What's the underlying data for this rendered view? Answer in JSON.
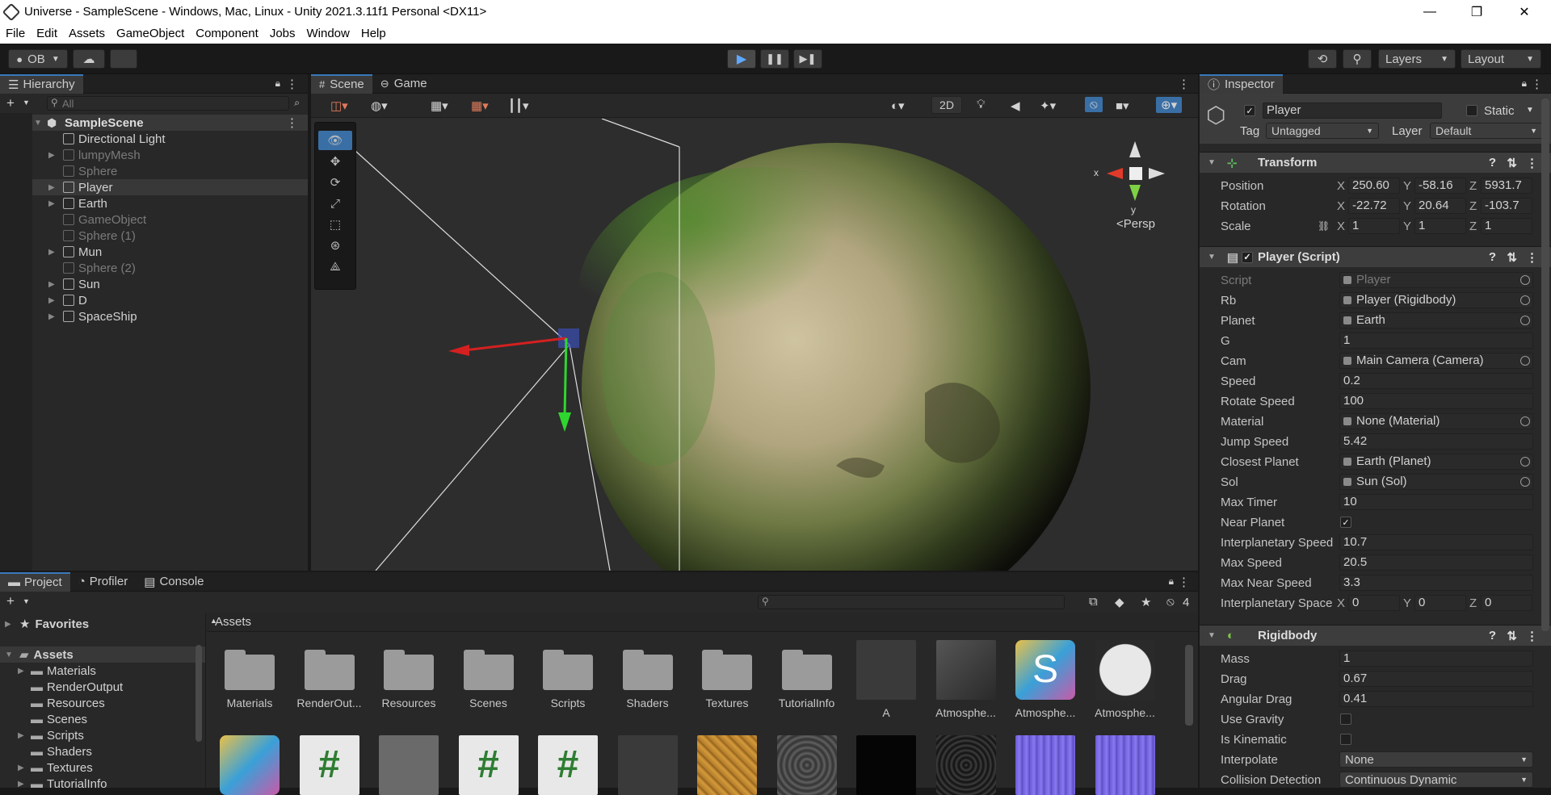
{
  "window": {
    "title": "Universe - SampleScene - Windows, Mac, Linux - Unity 2021.3.11f1 Personal <DX11>",
    "min": "—",
    "restore": "❐",
    "close": "✕"
  },
  "menu": [
    "File",
    "Edit",
    "Assets",
    "GameObject",
    "Component",
    "Jobs",
    "Window",
    "Help"
  ],
  "toolbar": {
    "account": "OB",
    "layers": "Layers",
    "layout": "Layout"
  },
  "hierarchy": {
    "tab": "Hierarchy",
    "search_placeholder": "All",
    "scene": "SampleScene",
    "items": [
      {
        "label": "Directional Light",
        "dim": false,
        "expand": false
      },
      {
        "label": "lumpyMesh",
        "dim": true,
        "expand": true
      },
      {
        "label": "Sphere",
        "dim": true,
        "expand": false
      },
      {
        "label": "Player",
        "dim": false,
        "expand": true,
        "selected": true
      },
      {
        "label": "Earth",
        "dim": false,
        "expand": true
      },
      {
        "label": "GameObject",
        "dim": true,
        "expand": false
      },
      {
        "label": "Sphere (1)",
        "dim": true,
        "expand": false
      },
      {
        "label": "Mun",
        "dim": false,
        "expand": true
      },
      {
        "label": "Sphere (2)",
        "dim": true,
        "expand": false
      },
      {
        "label": "Sun",
        "dim": false,
        "expand": true
      },
      {
        "label": "D",
        "dim": false,
        "expand": true
      },
      {
        "label": "SpaceShip",
        "dim": false,
        "expand": true
      }
    ]
  },
  "scene": {
    "tab_scene": "Scene",
    "tab_game": "Game",
    "mode_2d": "2D",
    "persp": "Persp",
    "axis_x": "x",
    "axis_y": "y"
  },
  "inspector": {
    "tab": "Inspector",
    "object_name": "Player",
    "static_label": "Static",
    "tag_label": "Tag",
    "tag_value": "Untagged",
    "layer_label": "Layer",
    "layer_value": "Default",
    "transform": {
      "title": "Transform",
      "position_label": "Position",
      "position": {
        "x": "250.60",
        "y": "-58.16",
        "z": "5931.7"
      },
      "rotation_label": "Rotation",
      "rotation": {
        "x": "-22.72",
        "y": "20.64",
        "z": "-103.7"
      },
      "scale_label": "Scale",
      "scale": {
        "x": "1",
        "y": "1",
        "z": "1"
      }
    },
    "player_script": {
      "title": "Player (Script)",
      "fields": [
        {
          "label": "Script",
          "value": "Player",
          "type": "obj",
          "dim": true
        },
        {
          "label": "Rb",
          "value": "Player (Rigidbody)",
          "type": "obj"
        },
        {
          "label": "Planet",
          "value": "Earth",
          "type": "obj"
        },
        {
          "label": "G",
          "value": "1",
          "type": "text"
        },
        {
          "label": "Cam",
          "value": "Main Camera (Camera)",
          "type": "obj"
        },
        {
          "label": "Speed",
          "value": "0.2",
          "type": "text"
        },
        {
          "label": "Rotate Speed",
          "value": "100",
          "type": "text"
        },
        {
          "label": "Material",
          "value": "None (Material)",
          "type": "obj"
        },
        {
          "label": "Jump Speed",
          "value": "5.42",
          "type": "text"
        },
        {
          "label": "Closest Planet",
          "value": "Earth (Planet)",
          "type": "obj"
        },
        {
          "label": "Sol",
          "value": "Sun (Sol)",
          "type": "obj"
        },
        {
          "label": "Max Timer",
          "value": "10",
          "type": "text"
        },
        {
          "label": "Near Planet",
          "value": "✓",
          "type": "check"
        },
        {
          "label": "Interplanetary Speed",
          "value": "10.7",
          "type": "text"
        },
        {
          "label": "Max Speed",
          "value": "20.5",
          "type": "text"
        },
        {
          "label": "Max Near Speed",
          "value": "3.3",
          "type": "text"
        }
      ],
      "space_label": "Interplanetary Space",
      "space": {
        "x": "0",
        "y": "0",
        "z": "0"
      }
    },
    "rigidbody": {
      "title": "Rigidbody",
      "fields": [
        {
          "label": "Mass",
          "value": "1",
          "type": "text"
        },
        {
          "label": "Drag",
          "value": "0.67",
          "type": "text"
        },
        {
          "label": "Angular Drag",
          "value": "0.41",
          "type": "text"
        },
        {
          "label": "Use Gravity",
          "value": "",
          "type": "check"
        },
        {
          "label": "Is Kinematic",
          "value": "",
          "type": "check"
        },
        {
          "label": "Interpolate",
          "value": "None",
          "type": "dropdown"
        },
        {
          "label": "Collision Detection",
          "value": "Continuous Dynamic",
          "type": "dropdown"
        }
      ]
    }
  },
  "project": {
    "tabs": [
      "Project",
      "Profiler",
      "Console"
    ],
    "hidden_count": "4",
    "favorites": "Favorites",
    "assets_root": "Assets",
    "tree": [
      "Materials",
      "RenderOutput",
      "Resources",
      "Scenes",
      "Scripts",
      "Shaders",
      "Textures",
      "TutorialInfo"
    ],
    "breadcrumb": "Assets",
    "grid_row1": [
      "Materials",
      "RenderOut...",
      "Resources",
      "Scenes",
      "Scripts",
      "Shaders",
      "Textures",
      "TutorialInfo",
      "A",
      "Atmosphe...",
      "Atmosphe...",
      "Atmosphe..."
    ]
  }
}
